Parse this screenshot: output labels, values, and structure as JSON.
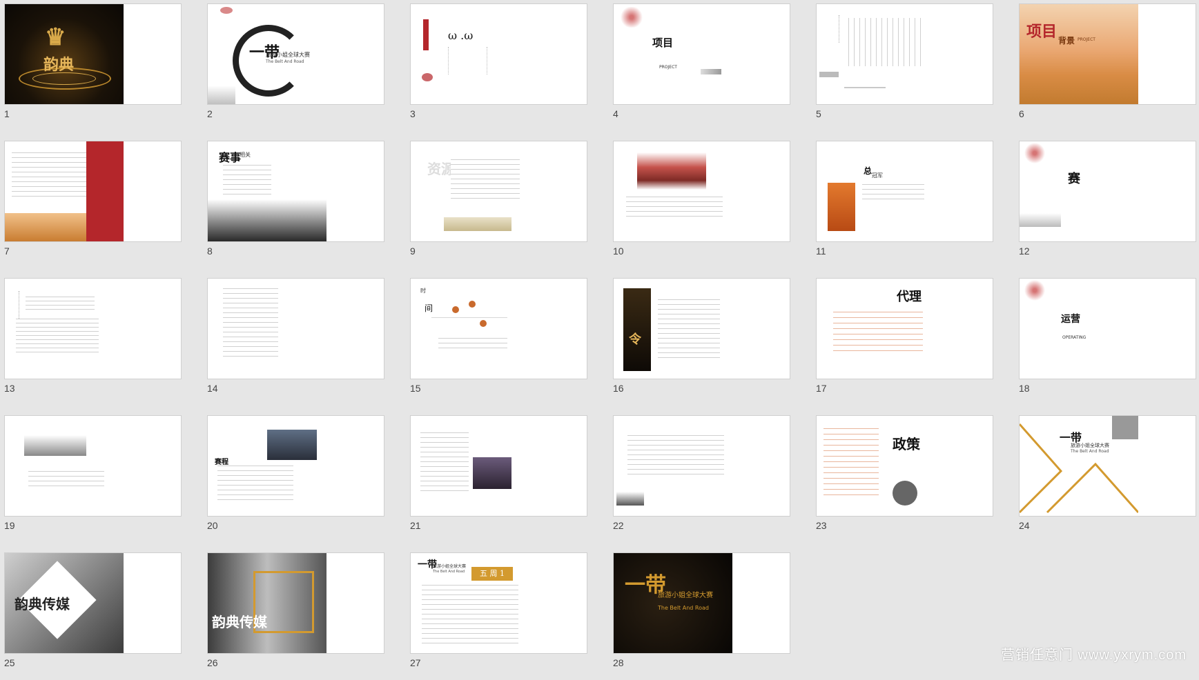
{
  "slide_numbers": [
    "1",
    "2",
    "3",
    "4",
    "5",
    "6",
    "7",
    "8",
    "9",
    "10",
    "11",
    "12",
    "13",
    "14",
    "15",
    "16",
    "17",
    "18",
    "19",
    "20",
    "21",
    "22",
    "23",
    "24",
    "25",
    "26",
    "27",
    "28"
  ],
  "slides": {
    "s1": {
      "title": "韵典"
    },
    "s2": {
      "title": "旅游小姐全球大赛",
      "subtitle": "The Belt And Road"
    },
    "s4": {
      "title": "项目",
      "subtitle": "PROJECT"
    },
    "s6": {
      "title": "项目",
      "word": "背景",
      "subtitle": "PROJECT"
    },
    "s8": {
      "title": "赛事",
      "word": "相关"
    },
    "s9": {
      "title": "资源"
    },
    "s11": {
      "title": "总",
      "word": "冠军"
    },
    "s12": {
      "title": "赛"
    },
    "s15": {
      "title": "时",
      "word": "间"
    },
    "s17": {
      "title": "代理"
    },
    "s18": {
      "title": "运营",
      "subtitle": "OPERATING"
    },
    "s20": {
      "title": "赛程"
    },
    "s23": {
      "title": "政策"
    },
    "s24": {
      "title": "旅游小姐全球大赛",
      "subtitle": "The Belt And Road"
    },
    "s25": {
      "title": "韵典传媒"
    },
    "s26": {
      "title": "韵典传媒"
    },
    "s27": {
      "title": "旅游小姐全球大赛",
      "subtitle": "The Belt And Road",
      "badge": "五 周 1"
    },
    "s28": {
      "title": "旅游小姐全球大赛",
      "subtitle": "The Belt And Road"
    }
  },
  "watermark": "营销任意门 www.yxrym.com",
  "colors": {
    "background": "#e6e6e6",
    "gold": "#d39a2f",
    "red": "#b4262b",
    "slide": "#ffffff"
  }
}
